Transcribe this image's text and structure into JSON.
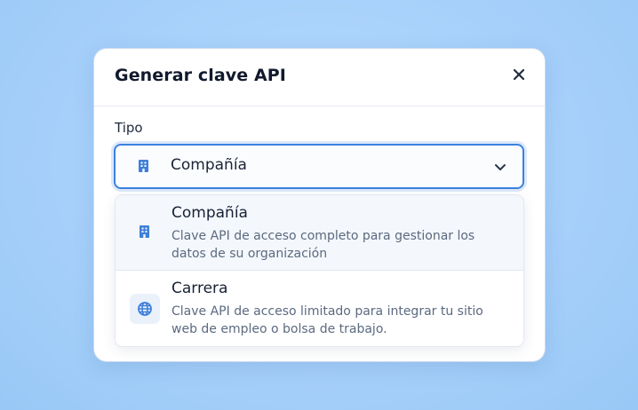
{
  "dialog": {
    "title": "Generar clave API",
    "close_icon": "close-icon"
  },
  "form": {
    "type_label": "Tipo",
    "selected": {
      "label": "Compañía",
      "icon": "building-icon"
    }
  },
  "dropdown": {
    "options": [
      {
        "title": "Compañía",
        "description": "Clave API de acceso completo para gestionar los datos de su organización",
        "icon": "building-icon",
        "highlighted": true
      },
      {
        "title": "Carrera",
        "description": "Clave API de acceso limitado para integrar tu sitio web de empleo o bolsa de trabajo.",
        "icon": "globe-icon",
        "highlighted": false
      }
    ]
  },
  "colors": {
    "accent": "#3b82e0",
    "icon_blue": "#3f7fd9",
    "title": "#101a2c",
    "muted": "#5b6a80"
  }
}
